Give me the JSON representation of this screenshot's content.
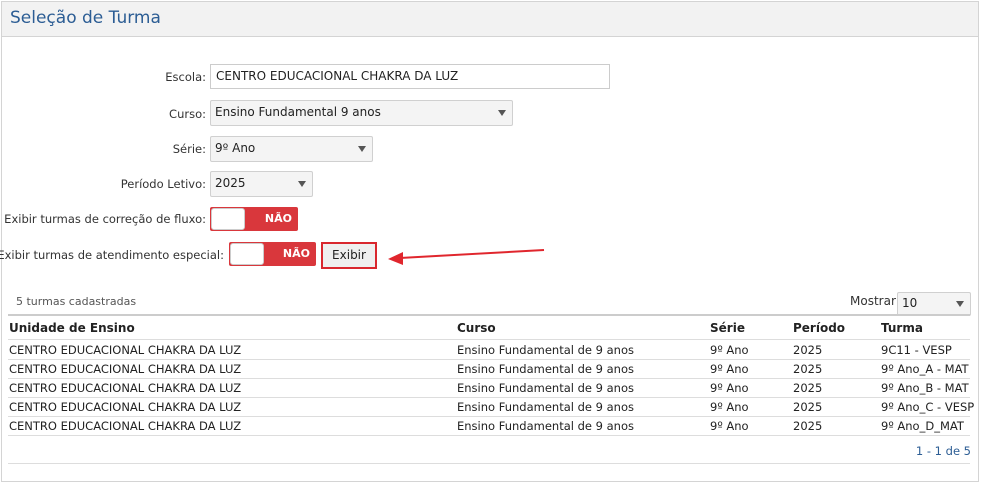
{
  "panel": {
    "title": "Seleção de Turma"
  },
  "form": {
    "escola": {
      "label": "Escola:",
      "value": "CENTRO EDUCACIONAL CHAKRA DA LUZ"
    },
    "curso": {
      "label": "Curso:",
      "value": "Ensino Fundamental 9 anos"
    },
    "serie": {
      "label": "Série:",
      "value": "9º Ano"
    },
    "periodo": {
      "label": "Período Letivo:",
      "value": "2025"
    },
    "correcao": {
      "label": "Exibir turmas de correção de fluxo:",
      "state": "NÃO"
    },
    "especial": {
      "label": "Exibir turmas de atendimento especial:",
      "state": "NÃO"
    },
    "exibir_button": "Exibir"
  },
  "table": {
    "count_text": "5 turmas cadastradas",
    "mostrar_label": "Mostrar:",
    "mostrar_value": "10",
    "headers": [
      "Unidade de Ensino",
      "Curso",
      "Série",
      "Período",
      "Turma"
    ],
    "rows": [
      [
        "CENTRO EDUCACIONAL CHAKRA DA LUZ",
        "Ensino Fundamental de 9 anos",
        "9º Ano",
        "2025",
        "9C11 - VESP"
      ],
      [
        "CENTRO EDUCACIONAL CHAKRA DA LUZ",
        "Ensino Fundamental de 9 anos",
        "9º Ano",
        "2025",
        "9º Ano_A - MAT"
      ],
      [
        "CENTRO EDUCACIONAL CHAKRA DA LUZ",
        "Ensino Fundamental de 9 anos",
        "9º Ano",
        "2025",
        "9º Ano_B - MAT"
      ],
      [
        "CENTRO EDUCACIONAL CHAKRA DA LUZ",
        "Ensino Fundamental de 9 anos",
        "9º Ano",
        "2025",
        "9º Ano_C - VESP"
      ],
      [
        "CENTRO EDUCACIONAL CHAKRA DA LUZ",
        "Ensino Fundamental de 9 anos",
        "9º Ano",
        "2025",
        "9º Ano_D_MAT"
      ]
    ],
    "pagination": "1 - 1 de 5"
  },
  "colors": {
    "title_blue": "#2c5d94",
    "toggle_red": "#d9373c",
    "highlight_red": "#d9272e"
  }
}
